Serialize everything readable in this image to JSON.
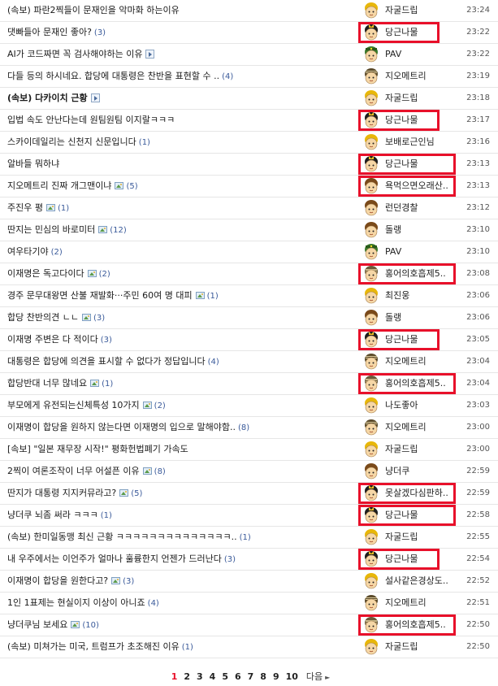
{
  "posts": [
    {
      "title": "(속보) 파란2찍들이 문재인을 악마화 하는이유",
      "count": "",
      "img": false,
      "video": false,
      "bold": false,
      "author": "자굴드립",
      "avatar": "yellow",
      "time": "23:24",
      "hl": ""
    },
    {
      "title": "댓빠들아 문재인 좋아?",
      "count": "(3)",
      "img": false,
      "video": false,
      "bold": false,
      "author": "당근나물",
      "avatar": "crown",
      "time": "23:22",
      "hl": "hl"
    },
    {
      "title": "AI가 코드짜면 꼭 검사해야하는 이유",
      "count": "",
      "img": false,
      "video": true,
      "bold": false,
      "author": "PAV",
      "avatar": "green",
      "time": "23:22",
      "hl": ""
    },
    {
      "title": "다들 등의 하시네요. 합당에 대통령은 찬반을 표현할 수 ..",
      "count": "(4)",
      "img": false,
      "video": false,
      "bold": false,
      "author": "지오메트리",
      "avatar": "stripe",
      "time": "23:19",
      "hl": ""
    },
    {
      "title": "(속보) 다카이치 근황",
      "count": "",
      "img": false,
      "video": true,
      "bold": true,
      "author": "자굴드립",
      "avatar": "yellow",
      "time": "23:18",
      "hl": ""
    },
    {
      "title": "입법 속도 안난다는데 원팀원팀 이지랄ㅋㅋㅋ",
      "count": "",
      "img": false,
      "video": false,
      "bold": false,
      "author": "당근나물",
      "avatar": "crown",
      "time": "23:17",
      "hl": "hl"
    },
    {
      "title": "스카이데일리는 신천지 신문입니다",
      "count": "(1)",
      "img": false,
      "video": false,
      "bold": false,
      "author": "보배로근인님",
      "avatar": "yellow",
      "time": "23:16",
      "hl": ""
    },
    {
      "title": "알바들 뭐하냐",
      "count": "",
      "img": false,
      "video": false,
      "bold": false,
      "author": "당근나물",
      "avatar": "crown",
      "time": "23:13",
      "hl": "hl-wide"
    },
    {
      "title": "지오메트리 진짜 개그맨이냐",
      "count": "(5)",
      "img": true,
      "video": false,
      "bold": false,
      "author": "욕먹으면오래산..",
      "avatar": "brown",
      "time": "23:13",
      "hl": "hl-wide"
    },
    {
      "title": "주진우 평",
      "count": "(1)",
      "img": true,
      "video": false,
      "bold": false,
      "author": "런던경찰",
      "avatar": "brown",
      "time": "23:12",
      "hl": ""
    },
    {
      "title": "딴지는 민심의 바로미터",
      "count": "(12)",
      "img": true,
      "video": false,
      "bold": false,
      "author": "돌랭",
      "avatar": "brown",
      "time": "23:10",
      "hl": ""
    },
    {
      "title": "여우타기야",
      "count": "(2)",
      "img": false,
      "video": false,
      "bold": false,
      "author": "PAV",
      "avatar": "green",
      "time": "23:10",
      "hl": ""
    },
    {
      "title": "이재명은 독고다이다",
      "count": "(2)",
      "img": true,
      "video": false,
      "bold": false,
      "author": "홍어의호흡제5..",
      "avatar": "band",
      "time": "23:08",
      "hl": "hl-wide"
    },
    {
      "title": "경주 문무대왕면 산불 재발화···주민 60여 명 대피",
      "count": "(1)",
      "img": true,
      "video": false,
      "bold": false,
      "author": "최진웅",
      "avatar": "yellow",
      "time": "23:06",
      "hl": ""
    },
    {
      "title": "합당 찬반의견 ㄴㄴ",
      "count": "(3)",
      "img": true,
      "video": false,
      "bold": false,
      "author": "돌랭",
      "avatar": "brown",
      "time": "23:06",
      "hl": ""
    },
    {
      "title": "이재명 주변은 다 적이다",
      "count": "(3)",
      "img": false,
      "video": false,
      "bold": false,
      "author": "당근나물",
      "avatar": "crown",
      "time": "23:05",
      "hl": "hl"
    },
    {
      "title": "대통령은 합당에 의견을 표시할 수 없다가 정답입니다",
      "count": "(4)",
      "img": false,
      "video": false,
      "bold": false,
      "author": "지오메트리",
      "avatar": "stripe",
      "time": "23:04",
      "hl": ""
    },
    {
      "title": "합당반대 너무 많네요",
      "count": "(1)",
      "img": true,
      "video": false,
      "bold": false,
      "author": "홍어의호흡제5..",
      "avatar": "band",
      "time": "23:04",
      "hl": "hl-wide"
    },
    {
      "title": "부모에게 유전되는신체특성 10가지",
      "count": "(2)",
      "img": true,
      "video": false,
      "bold": false,
      "author": "나도좋아",
      "avatar": "yellow",
      "time": "23:03",
      "hl": ""
    },
    {
      "title": "이재명이 합당을 원하지 않는다면 이재명의 입으로 말해야함..",
      "count": "(8)",
      "img": false,
      "video": false,
      "bold": false,
      "author": "지오메트리",
      "avatar": "stripe",
      "time": "23:00",
      "hl": ""
    },
    {
      "title": "[속보] \"일본 재무장 시작!\" 평화헌법폐기 가속도",
      "count": "",
      "img": false,
      "video": false,
      "bold": false,
      "author": "자굴드립",
      "avatar": "yellow",
      "time": "23:00",
      "hl": ""
    },
    {
      "title": "2찍이 여론조작이 너무 어설픈 이유",
      "count": "(8)",
      "img": true,
      "video": false,
      "bold": false,
      "author": "냥더쿠",
      "avatar": "brown",
      "time": "22:59",
      "hl": ""
    },
    {
      "title": "딴지가 대통령 지지커뮤라고?",
      "count": "(5)",
      "img": true,
      "video": false,
      "bold": false,
      "author": "못살겠다심판하..",
      "avatar": "crown",
      "time": "22:59",
      "hl": "hl-tall"
    },
    {
      "title": "냥더쿠 뇌좀 써라 ㅋㅋㅋ",
      "count": "(1)",
      "img": false,
      "video": false,
      "bold": false,
      "author": "당근나물",
      "avatar": "crown",
      "time": "22:58",
      "hl": "hl-tall"
    },
    {
      "title": "(속보) 한미일동맹 최신 근황 ㅋㅋㅋㅋㅋㅋㅋㅋㅋㅋㅋㅋㅋㅋ..",
      "count": "(1)",
      "img": false,
      "video": false,
      "bold": false,
      "author": "자굴드립",
      "avatar": "yellow",
      "time": "22:55",
      "hl": ""
    },
    {
      "title": "내 우주에서는 이언주가 얼마나 훌륭한지 언젠가 드러난다",
      "count": "(3)",
      "img": false,
      "video": false,
      "bold": false,
      "author": "당근나물",
      "avatar": "crown",
      "time": "22:54",
      "hl": "hl"
    },
    {
      "title": "이재명이 합당을 원한다고?",
      "count": "(3)",
      "img": true,
      "video": false,
      "bold": false,
      "author": "설사같은경상도..",
      "avatar": "yellow",
      "time": "22:52",
      "hl": ""
    },
    {
      "title": "1인 1표제는 현실이지 이상이 아니죠",
      "count": "(4)",
      "img": false,
      "video": false,
      "bold": false,
      "author": "지오메트리",
      "avatar": "stripe",
      "time": "22:51",
      "hl": ""
    },
    {
      "title": "냥더쿠님 보세요",
      "count": "(10)",
      "img": true,
      "video": false,
      "bold": false,
      "author": "홍어의호흡제5..",
      "avatar": "band",
      "time": "22:50",
      "hl": "hl-wide"
    },
    {
      "title": "(속보) 미쳐가는 미국, 트럼프가 초조해진 이유",
      "count": "(1)",
      "img": false,
      "video": false,
      "bold": false,
      "author": "자굴드립",
      "avatar": "yellow",
      "time": "22:50",
      "hl": ""
    }
  ],
  "pagination": {
    "pages": [
      "1",
      "2",
      "3",
      "4",
      "5",
      "6",
      "7",
      "8",
      "9",
      "10"
    ],
    "current": "1",
    "next_label": "다음",
    "next_arrow": "►"
  },
  "colors": {
    "highlight": "#e8102a",
    "current_page": "#e8102a",
    "count": "#3a5a9a"
  },
  "icons": {
    "image": "image-attachment-icon",
    "video": "video-play-icon"
  }
}
